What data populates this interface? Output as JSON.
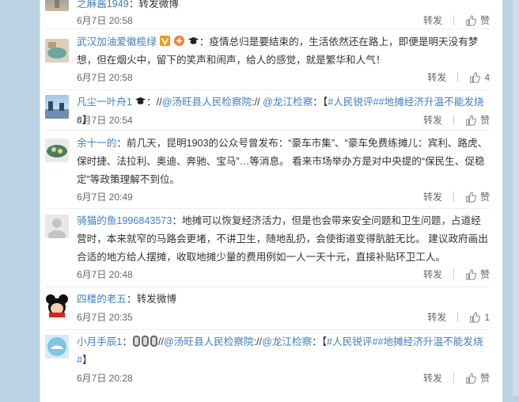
{
  "comments": [
    {
      "user": "之麻酱1949",
      "sep": "：",
      "text": "转发微博",
      "time": "6月7日 20:58",
      "repost": "转发",
      "like": "赞"
    },
    {
      "user": "武汉加油爱徽榄绿",
      "sep": "：",
      "text": "疫情总归是要结束的，生活依然还在路上，即便是明天没有梦想，但在烟火中，留下的笑声和闹声，给人的感觉，就是繁华和人气！",
      "time": "6月7日 20:58",
      "repost": "转发",
      "like": "4"
    },
    {
      "user": "凡尘一叶舟1",
      "text_prefix": "：//",
      "mention1": "@汤旺县人民检察院",
      "mid": ":// ",
      "mention2": "@龙江检察",
      "bracket_open": "：【",
      "topic1": "#人民锐评#",
      "topic2": "#地摊经济升温不能发烧#",
      "bracket_close": "】",
      "time": "6月7日 20:54",
      "repost": "转发",
      "like": "赞"
    },
    {
      "user": "余十一的",
      "sep": "：",
      "text": "前几天，昆明1903的公众号曾发布：“豪车市集”、“豪车免费练摊儿：宾利、路虎、保时捷、法拉利、奥迪、奔驰、宝马”…等消息。 看来市场举办方是对中央提的“保民生、促稳定”等政策理解不到位。",
      "time": "6月7日 20:49",
      "repost": "转发",
      "like": "赞"
    },
    {
      "user": "骑猫的鱼1996843573",
      "sep": "：",
      "text": "地摊可以恢复经济活力，但是也会带来安全问题和卫生问题，占道经营时，本来就窄的马路会更堵，不讲卫生，随地乱扔，会使街道变得肮脏无比。 建议政府画出合适的地方给人摆摊，收取地摊少量的费用例如一人一天十元，直接补贴环卫工人。",
      "time": "6月7日 20:48",
      "repost": "转发",
      "like": "赞"
    },
    {
      "user": "四楼的老五",
      "sep": "：",
      "text": "转发微博",
      "time": "6月7日 20:35",
      "repost": "转发",
      "like": "1"
    },
    {
      "user": "小月手辰1",
      "text_prefix": "：",
      "mid_prefix": "//",
      "mention1": "@汤旺县人民检察院",
      "mid": "://",
      "mention2": "@龙江检察",
      "bracket_open": "：【",
      "topic1": "#人民锐评#",
      "topic2": "#地摊经济升温不能发烧#",
      "bracket_close": "】",
      "time": "6月7日 20:28",
      "repost": "转发",
      "like": "赞"
    }
  ],
  "colors": {
    "username": "#eb7350",
    "link": "#3f7fbf",
    "background": "#bcd3e4"
  }
}
